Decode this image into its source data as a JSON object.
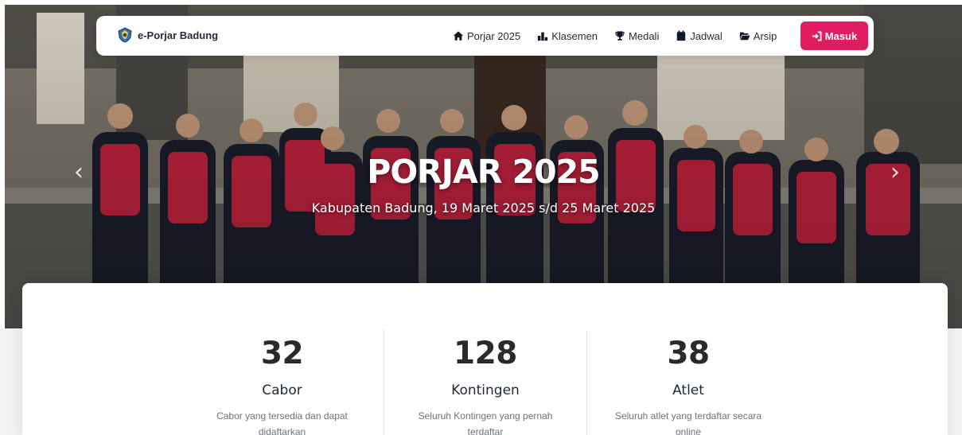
{
  "brand": {
    "name": "e-Porjar Badung",
    "logo_icon": "badung-crest-icon"
  },
  "nav": {
    "items": [
      {
        "label": "Porjar 2025",
        "icon": "home-icon"
      },
      {
        "label": "Klasemen",
        "icon": "podium-icon"
      },
      {
        "label": "Medali",
        "icon": "trophy-icon"
      },
      {
        "label": "Jadwal",
        "icon": "calendar-icon"
      },
      {
        "label": "Arsip",
        "icon": "folder-open-icon"
      }
    ],
    "login_label": "Masuk",
    "login_icon": "sign-in-icon"
  },
  "hero": {
    "title": "PORJAR 2025",
    "subtitle": "Kabupaten Badung, 19 Maret 2025 s/d 25 Maret 2025",
    "prev_icon": "chevron-left-icon",
    "next_icon": "chevron-right-icon"
  },
  "stats": [
    {
      "value": "32",
      "label": "Cabor",
      "desc": "Cabor yang tersedia dan dapat didaftarkan"
    },
    {
      "value": "128",
      "label": "Kontingen",
      "desc": "Seluruh Kontingen yang pernah terdaftar"
    },
    {
      "value": "38",
      "label": "Atlet",
      "desc": "Seluruh atlet yang terdaftar secara online"
    }
  ],
  "colors": {
    "accent": "#e11d62",
    "text": "#1f2937",
    "muted": "#6b7280"
  }
}
